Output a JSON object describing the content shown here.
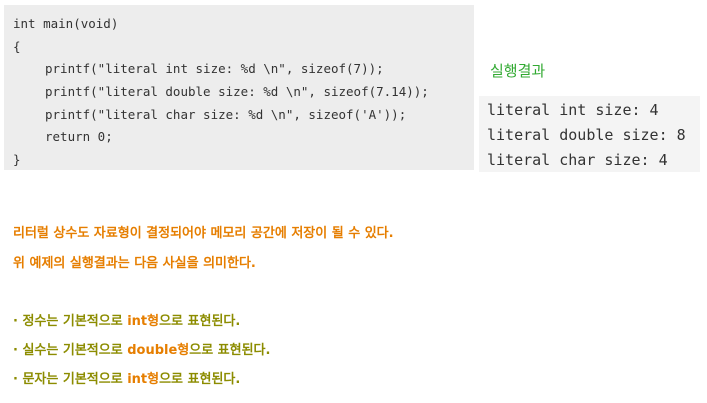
{
  "code": {
    "lines": [
      "int main(void)",
      "{",
      "printf(\"literal int size: %d \\n\", sizeof(7));",
      "printf(\"literal double size: %d \\n\", sizeof(7.14));",
      "printf(\"literal char size: %d \\n\", sizeof('A'));",
      "return 0;",
      "}"
    ]
  },
  "result": {
    "label": "실행결과",
    "lines": [
      "literal int size: 4",
      "literal double size: 8",
      "literal char size: 4"
    ]
  },
  "description": {
    "line1": "리터럴 상수도 자료형이 결정되어야 메모리 공간에 저장이 될 수 있다.",
    "line2": "위 예제의 실행결과는 다음 사실을 의미한다."
  },
  "bullets": [
    {
      "prefix": "· 정수는 기본적으로 ",
      "type": "int형",
      "suffix": "으로 표현된다."
    },
    {
      "prefix": "· 실수는 기본적으로 ",
      "type": "double형",
      "suffix": "으로 표현된다."
    },
    {
      "prefix": "· 문자는 기본적으로 ",
      "type": "int형",
      "suffix": "으로 표현된다."
    }
  ],
  "colors": {
    "code_background": "#ededed",
    "result_label": "#33aa33",
    "description": "#e67e00",
    "bullet_text": "#8c8c00",
    "bullet_type": "#e67e00"
  }
}
